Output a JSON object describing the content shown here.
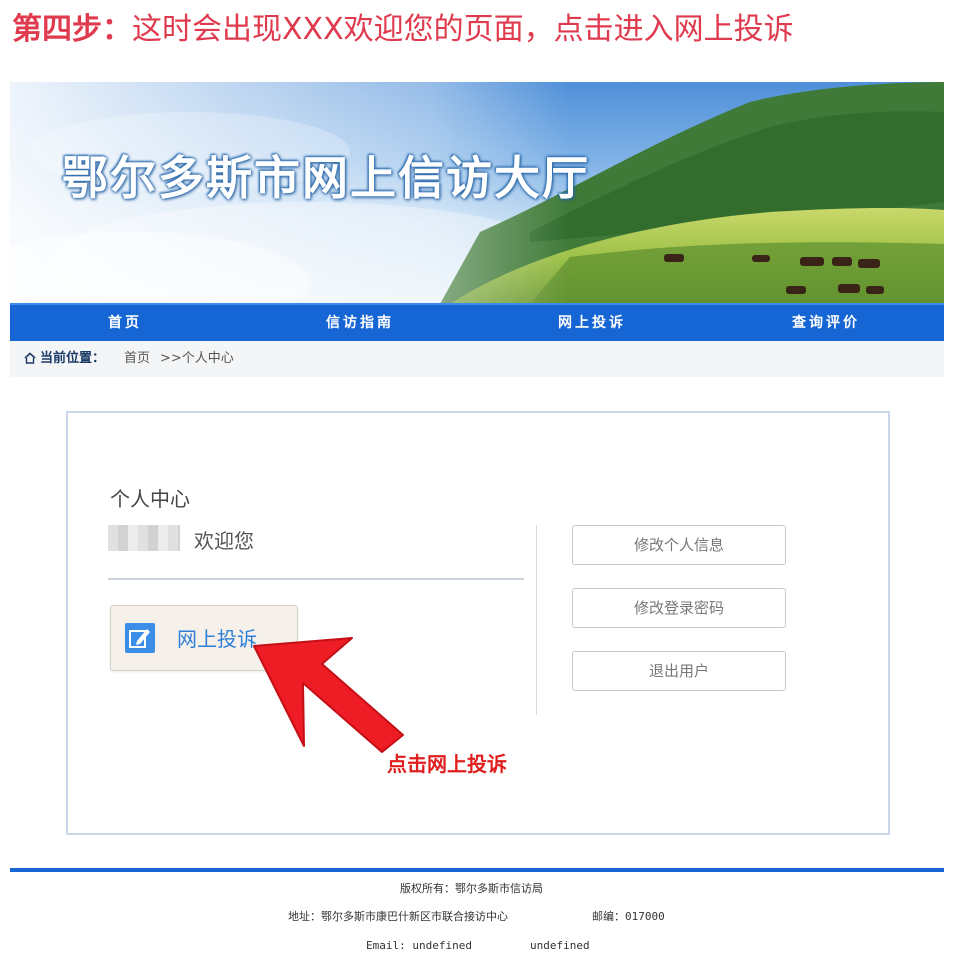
{
  "step_caption": {
    "label": "第四步：",
    "text": "这时会出现XXX欢迎您的页面，点击进入网上投诉"
  },
  "banner": {
    "title": "鄂尔多斯市网上信访大厅"
  },
  "nav": {
    "items": [
      {
        "label": "首页"
      },
      {
        "label": "信访指南"
      },
      {
        "label": "网上投诉"
      },
      {
        "label": "查询评价"
      }
    ]
  },
  "breadcrumb": {
    "icon": "home-icon",
    "label": "当前位置：",
    "home": "首页",
    "current": ">>个人中心"
  },
  "personal_center": {
    "title": "个人中心",
    "welcome": "欢迎您",
    "complaint_button": "网上投诉",
    "complaint_icon": "edit-icon",
    "side_buttons": [
      "修改个人信息",
      "修改登录密码",
      "退出用户"
    ]
  },
  "annotation": {
    "text": "点击网上投诉",
    "color": "#e02020"
  },
  "footer": {
    "copyright": "版权所有：鄂尔多斯市信访局",
    "address": "地址：鄂尔多斯市康巴什新区市联合接访中心",
    "postcode": "邮编：017000",
    "email": "Email: undefined",
    "extra": "undefined"
  },
  "colors": {
    "caption": "#e03a4e",
    "nav_bg": "#1566d4",
    "accent_blue": "#2f7fd8",
    "arrow_red": "#ee1c24"
  }
}
